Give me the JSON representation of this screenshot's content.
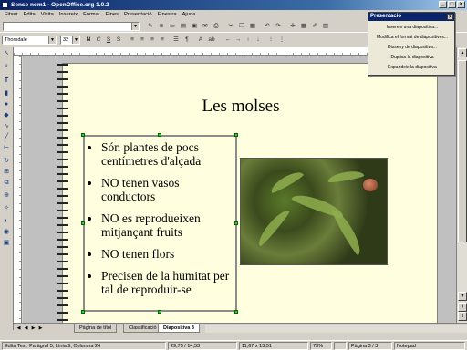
{
  "window": {
    "title": "Sense nom1 - OpenOffice.org 1.0.2"
  },
  "menubar": [
    "Fitxer",
    "Edita",
    "Visita",
    "Insereix",
    "Format",
    "Eines",
    "Presentació",
    "Finestra",
    "Ajuda"
  ],
  "toolbar": {
    "font_name": "Thorndale",
    "font_size": "32"
  },
  "slide": {
    "title": "Les molses",
    "bullets": [
      "Són plantes de pocs centímetres d'alçada",
      "NO tenen vasos conductors",
      "NO es reprodueixen mitjançant fruits",
      "NO tenen flors",
      "Precisen de la humitat per tal de reproduir-se"
    ]
  },
  "tabs": [
    "Pàgina de títol",
    "Classificació",
    "Diapositiva 3"
  ],
  "status": {
    "text": "Edita Text: Paràgraf 5, Línia 9, Columna 24",
    "position": "29,75 / 14,53",
    "size": "11,67 x 13,51",
    "zoom": "73%",
    "page": "Pàgina 3 / 3",
    "layout": "Notepad"
  },
  "task_panel": {
    "title": "Presentació",
    "items": [
      "Insereix una diapositiva...",
      "Modifica el format de diapositives...",
      "Disseny de diapositiva...",
      "Duplica la diapositiva",
      "Expandeix la diapositiva"
    ]
  }
}
